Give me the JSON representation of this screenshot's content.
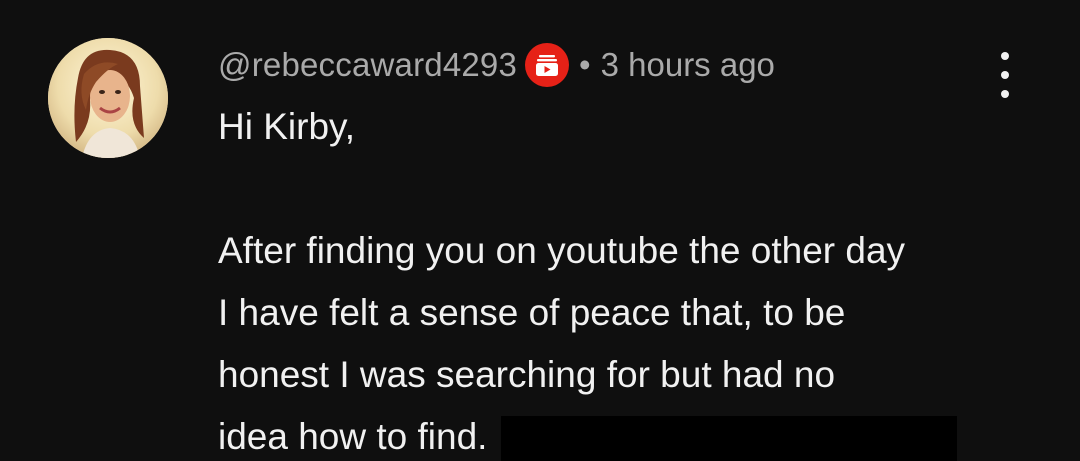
{
  "comment": {
    "author": "@rebeccaward4293",
    "badge_icon": "membership-badge-icon",
    "separator": "•",
    "timestamp": "3 hours ago",
    "menu_icon": "more-vert-icon",
    "body": {
      "greeting": "Hi Kirby,",
      "lines": [
        "After finding you on youtube the other day",
        "I have felt a sense of peace that, to be",
        "honest I was searching for but had no",
        "idea how to find."
      ]
    }
  },
  "colors": {
    "background": "#0f0f0f",
    "text": "#f1f1f1",
    "muted": "#aaaaaa",
    "badge": "#e62117"
  }
}
